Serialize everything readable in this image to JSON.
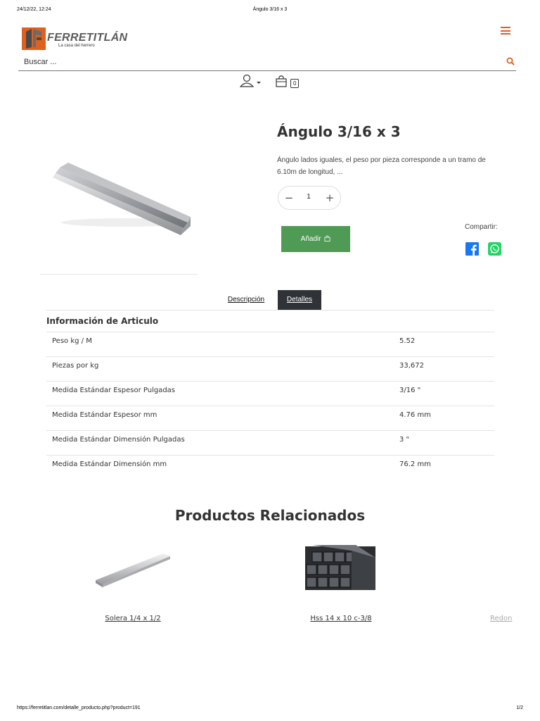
{
  "print": {
    "date": "24/12/22, 12:24",
    "title": "Ángulo 3/16 x 3",
    "url": "https://ferretitlan.com/detalle_producto.php?product=191",
    "page": "1/2"
  },
  "header": {
    "logo_name": "FERRETITLÁN",
    "logo_tagline": "La casa del herrero",
    "accent_color": "#e0601f",
    "search": {
      "placeholder": "Buscar ...",
      "value": ""
    },
    "cart_count": "0"
  },
  "product": {
    "title": "Ángulo 3/16 x 3",
    "description": "Ángulo lados iguales, el peso por pieza corresponde a un tramo de 6.10m de longitud, ...",
    "quantity": "1",
    "qty_minus": "−",
    "qty_plus": "+",
    "add_label": "Añadir",
    "add_color": "#4f9a55",
    "share_label": "Compartir:"
  },
  "tabs": [
    {
      "label": "Descripción",
      "active": false
    },
    {
      "label": "Detalles",
      "active": true
    }
  ],
  "details": {
    "heading": "Información de Articulo",
    "rows": [
      {
        "label": "Peso kg / M",
        "value": "5.52"
      },
      {
        "label": "Piezas por kg",
        "value": "33,672"
      },
      {
        "label": "Medida Estándar Espesor Pulgadas",
        "value": "3/16 \""
      },
      {
        "label": "Medida Estándar Espesor mm",
        "value": "4.76 mm"
      },
      {
        "label": "Medida Estándar Dimensión Pulgadas",
        "value": "3 \""
      },
      {
        "label": "Medida Estándar Dimensión mm",
        "value": "76.2 mm"
      }
    ]
  },
  "related": {
    "title": "Productos Relacionados",
    "items": [
      {
        "name": "Solera 1/4 x 1/2"
      },
      {
        "name": "Hss 14 x 10 c-3/8"
      },
      {
        "name": "Redon"
      }
    ]
  }
}
